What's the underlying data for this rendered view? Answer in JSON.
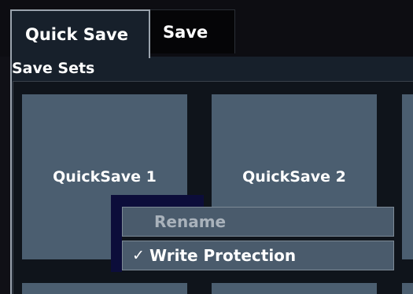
{
  "tabs": [
    {
      "label": "Quick Save",
      "active": true
    },
    {
      "label": "Save",
      "active": false
    }
  ],
  "section": {
    "title": "Save Sets"
  },
  "tiles": [
    {
      "label": "QuickSave 1"
    },
    {
      "label": "QuickSave 2"
    }
  ],
  "context_menu": {
    "items": [
      {
        "label": "Rename",
        "enabled": false
      },
      {
        "label": "Write Protection",
        "checked": true,
        "check_glyph": "✓"
      }
    ]
  },
  "colors": {
    "tile": "#4b5e70",
    "panel": "#17202b",
    "menu_item": "#4a5b6c",
    "disabled_text": "#a9b2bb"
  }
}
